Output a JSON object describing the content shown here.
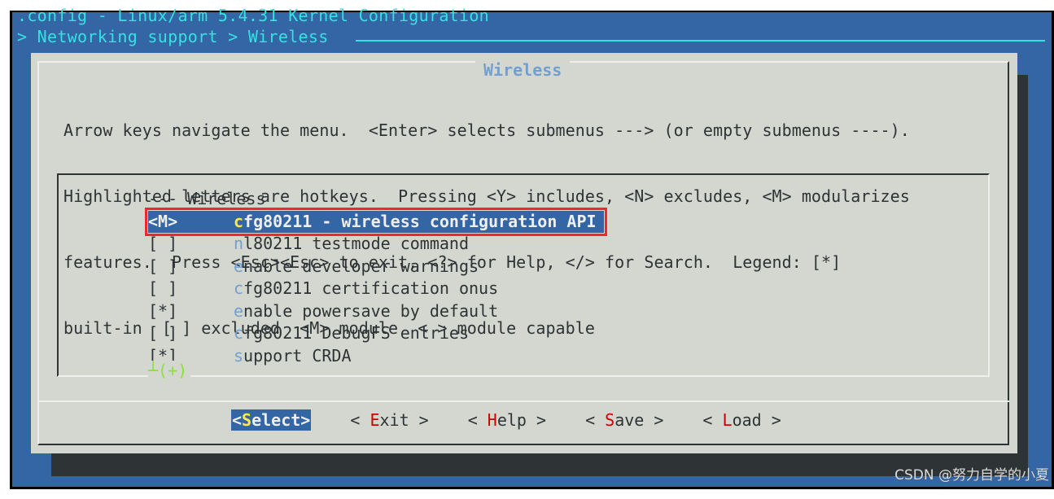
{
  "window": {
    "title": ".config - Linux/arm 5.4.31 Kernel Configuration",
    "breadcrumb": "> Networking support > Wireless"
  },
  "dialog": {
    "title": "Wireless",
    "help_lines": [
      "Arrow keys navigate the menu.  <Enter> selects submenus ---> (or empty submenus ----).",
      "Highlighted letters are hotkeys.  Pressing <Y> includes, <N> excludes, <M> modularizes",
      "features.  Press <Esc><Esc> to exit, <?> for Help, </> for Search.  Legend: [*]",
      "built-in  [ ] excluded  <M> module  < > module capable"
    ]
  },
  "menu": {
    "header": "--- Wireless",
    "items": [
      {
        "state": "<M>",
        "hotkey": "c",
        "rest": "fg80211 - wireless configuration API",
        "selected": true
      },
      {
        "state": "[ ]",
        "hotkey": "n",
        "rest": "l80211 testmode command",
        "selected": false
      },
      {
        "state": "[ ]",
        "hotkey": "e",
        "rest": "nable developer warnings",
        "selected": false
      },
      {
        "state": "[ ]",
        "hotkey": "c",
        "rest": "fg80211 certification onus",
        "selected": false
      },
      {
        "state": "[*]",
        "hotkey": "e",
        "rest": "nable powersave by default",
        "selected": false
      },
      {
        "state": "[ ]",
        "hotkey": "c",
        "rest": "fg80211 DebugFS entries",
        "selected": false
      },
      {
        "state": "[*]",
        "hotkey": "s",
        "rest": "upport CRDA",
        "selected": false
      }
    ],
    "more_indicator": "┴(+)"
  },
  "buttons": [
    {
      "pre": "<",
      "key": "S",
      "post": "elect>",
      "active": true
    },
    {
      "pre": "< ",
      "key": "E",
      "post": "xit >",
      "active": false
    },
    {
      "pre": "< ",
      "key": "H",
      "post": "elp >",
      "active": false
    },
    {
      "pre": "< ",
      "key": "S",
      "post": "ave >",
      "active": false
    },
    {
      "pre": "< ",
      "key": "L",
      "post": "oad >",
      "active": false
    }
  ],
  "watermark": "CSDN @努力自学的小夏",
  "colors": {
    "background_blue": "#3465a4",
    "title_cyan": "#34e2e2",
    "dialog_gray": "#d3d7cf",
    "hotkey_blue": "#729fcf",
    "selected_hotkey_yellow": "#fce94f",
    "button_key_red": "#cc0000",
    "annotation_red": "#ef2929",
    "more_green": "#8ae234"
  }
}
